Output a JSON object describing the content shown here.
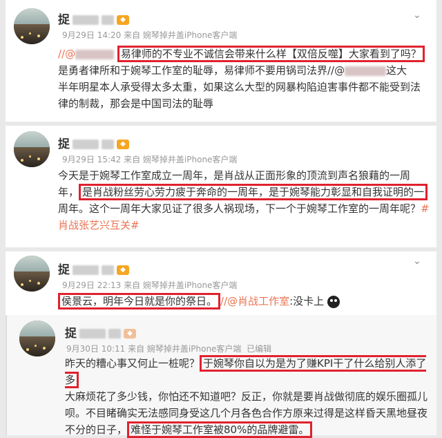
{
  "posts": [
    {
      "author": "捉",
      "meta": "9月29日 14:20 来自 婉琴掉井盖iPhone客户端",
      "line1_prefix": "//@",
      "line1_highlight": "易律师的不专业不诚信会带来什么样【双倍反噬】大家看到了吗？",
      "line2": "是勇者律所和于婉琴工作室的耻辱，易律师不要用锅司法界//@",
      "line2_suffix": "这大",
      "line3": "半年明星本人承受得太多太重，如果这么大型的网暴构陷迫害事件都不能受到法",
      "line4": "律的制裁，那会是中国司法的耻辱"
    },
    {
      "author": "捉",
      "meta": "9月29日 15:42 来自 婉琴掉井盖iPhone客户端",
      "line1": "今天是于婉琴工作室成立一周年，是肖战从正面形象的顶流到声名狼藉的一周",
      "line2_prefix": "年，",
      "line2_highlight": "是肖战粉丝劳心劳力疲于奔命的一周年，是于婉琴能力彰显和自我证明的一",
      "line3_text": "周年。这个一周年大家见证了很多人祸现场，下一个于婉琴工作室的一周年呢？",
      "line3_tag": "#",
      "line4_tag": "肖战张艺兴互关#"
    },
    {
      "author": "捉",
      "meta": "9月29日 22:13 来自 婉琴掉井盖iPhone客户端",
      "highlight": "侯景云，明年今日就是你的祭日。",
      "mention": "//@肖战工作室",
      "suffix": ":没卡上"
    },
    {
      "author": "捉",
      "meta_time": "9月30日 10:11 来自 婉琴掉井盖iPhone客户端",
      "meta_edited": "已编辑",
      "line1_prefix": "昨天的糟心事又何止一桩呢？",
      "line1_highlight": "于婉琴你自以为是为了赚KPI干了什么给别人添了多",
      "line2": "大麻烦花了多少钱，你怕还不知道吧？反正，你就是要肖战做彻底的娱乐圈孤儿",
      "line3": "呗。不目睹确实无法感同身受这几个月各色合作方原来过得是这样昏天黑地昼夜",
      "line4_prefix": "不分的日子，",
      "line4_highlight": "难怪于婉琴工作室被80%的品牌避雷。"
    }
  ],
  "colors": {
    "highlight_border": "#e0212e",
    "link": "#eb7350",
    "meta": "#999999"
  },
  "icons": [
    "chevron-down-icon",
    "vip-badge-icon",
    "emoji-icon"
  ]
}
